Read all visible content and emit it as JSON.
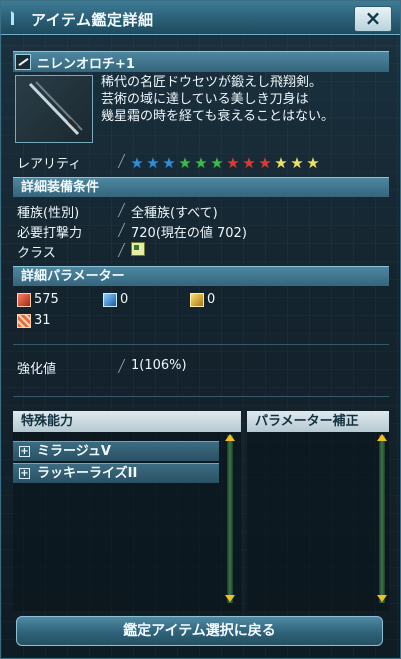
{
  "window": {
    "title": "アイテム鑑定詳細",
    "close_label": "×"
  },
  "item": {
    "name": "ニレンオロチ+1",
    "description": "稀代の名匠ドウセツが鍛えし飛翔剣。\n芸術の域に達している美しき刀身は\n幾星霜の時を経ても衰えることはない。"
  },
  "rarity": {
    "label": "レアリティ",
    "stars": [
      {
        "color": "#2a8fe0"
      },
      {
        "color": "#2a8fe0"
      },
      {
        "color": "#2a8fe0"
      },
      {
        "color": "#34c040"
      },
      {
        "color": "#34c040"
      },
      {
        "color": "#34c040"
      },
      {
        "color": "#e03a30"
      },
      {
        "color": "#e03a30"
      },
      {
        "color": "#e03a30"
      },
      {
        "color": "#f0e060"
      },
      {
        "color": "#f0e060"
      },
      {
        "color": "#f0e060"
      }
    ]
  },
  "requirements": {
    "header": "詳細装備条件",
    "race_label": "種族(性別)",
    "race_value": "全種族(すべて)",
    "attack_label": "必要打撃力",
    "attack_value": "720(現在の値 702)",
    "class_label": "クラス"
  },
  "parameters": {
    "header": "詳細パラメーター",
    "melee": "575",
    "ranged": "0",
    "tech": "0",
    "defense": "31"
  },
  "grind": {
    "label": "強化値",
    "value": "1(106%)"
  },
  "abilities": {
    "header": "特殊能力",
    "items": [
      "ミラージュV",
      "ラッキーライズII"
    ]
  },
  "param_bonus": {
    "header": "パラメーター補正"
  },
  "footer": {
    "back_button": "鑑定アイテム選択に戻る"
  },
  "colors": {
    "accent": "#3e7c96",
    "scroll": "#f0c020"
  }
}
